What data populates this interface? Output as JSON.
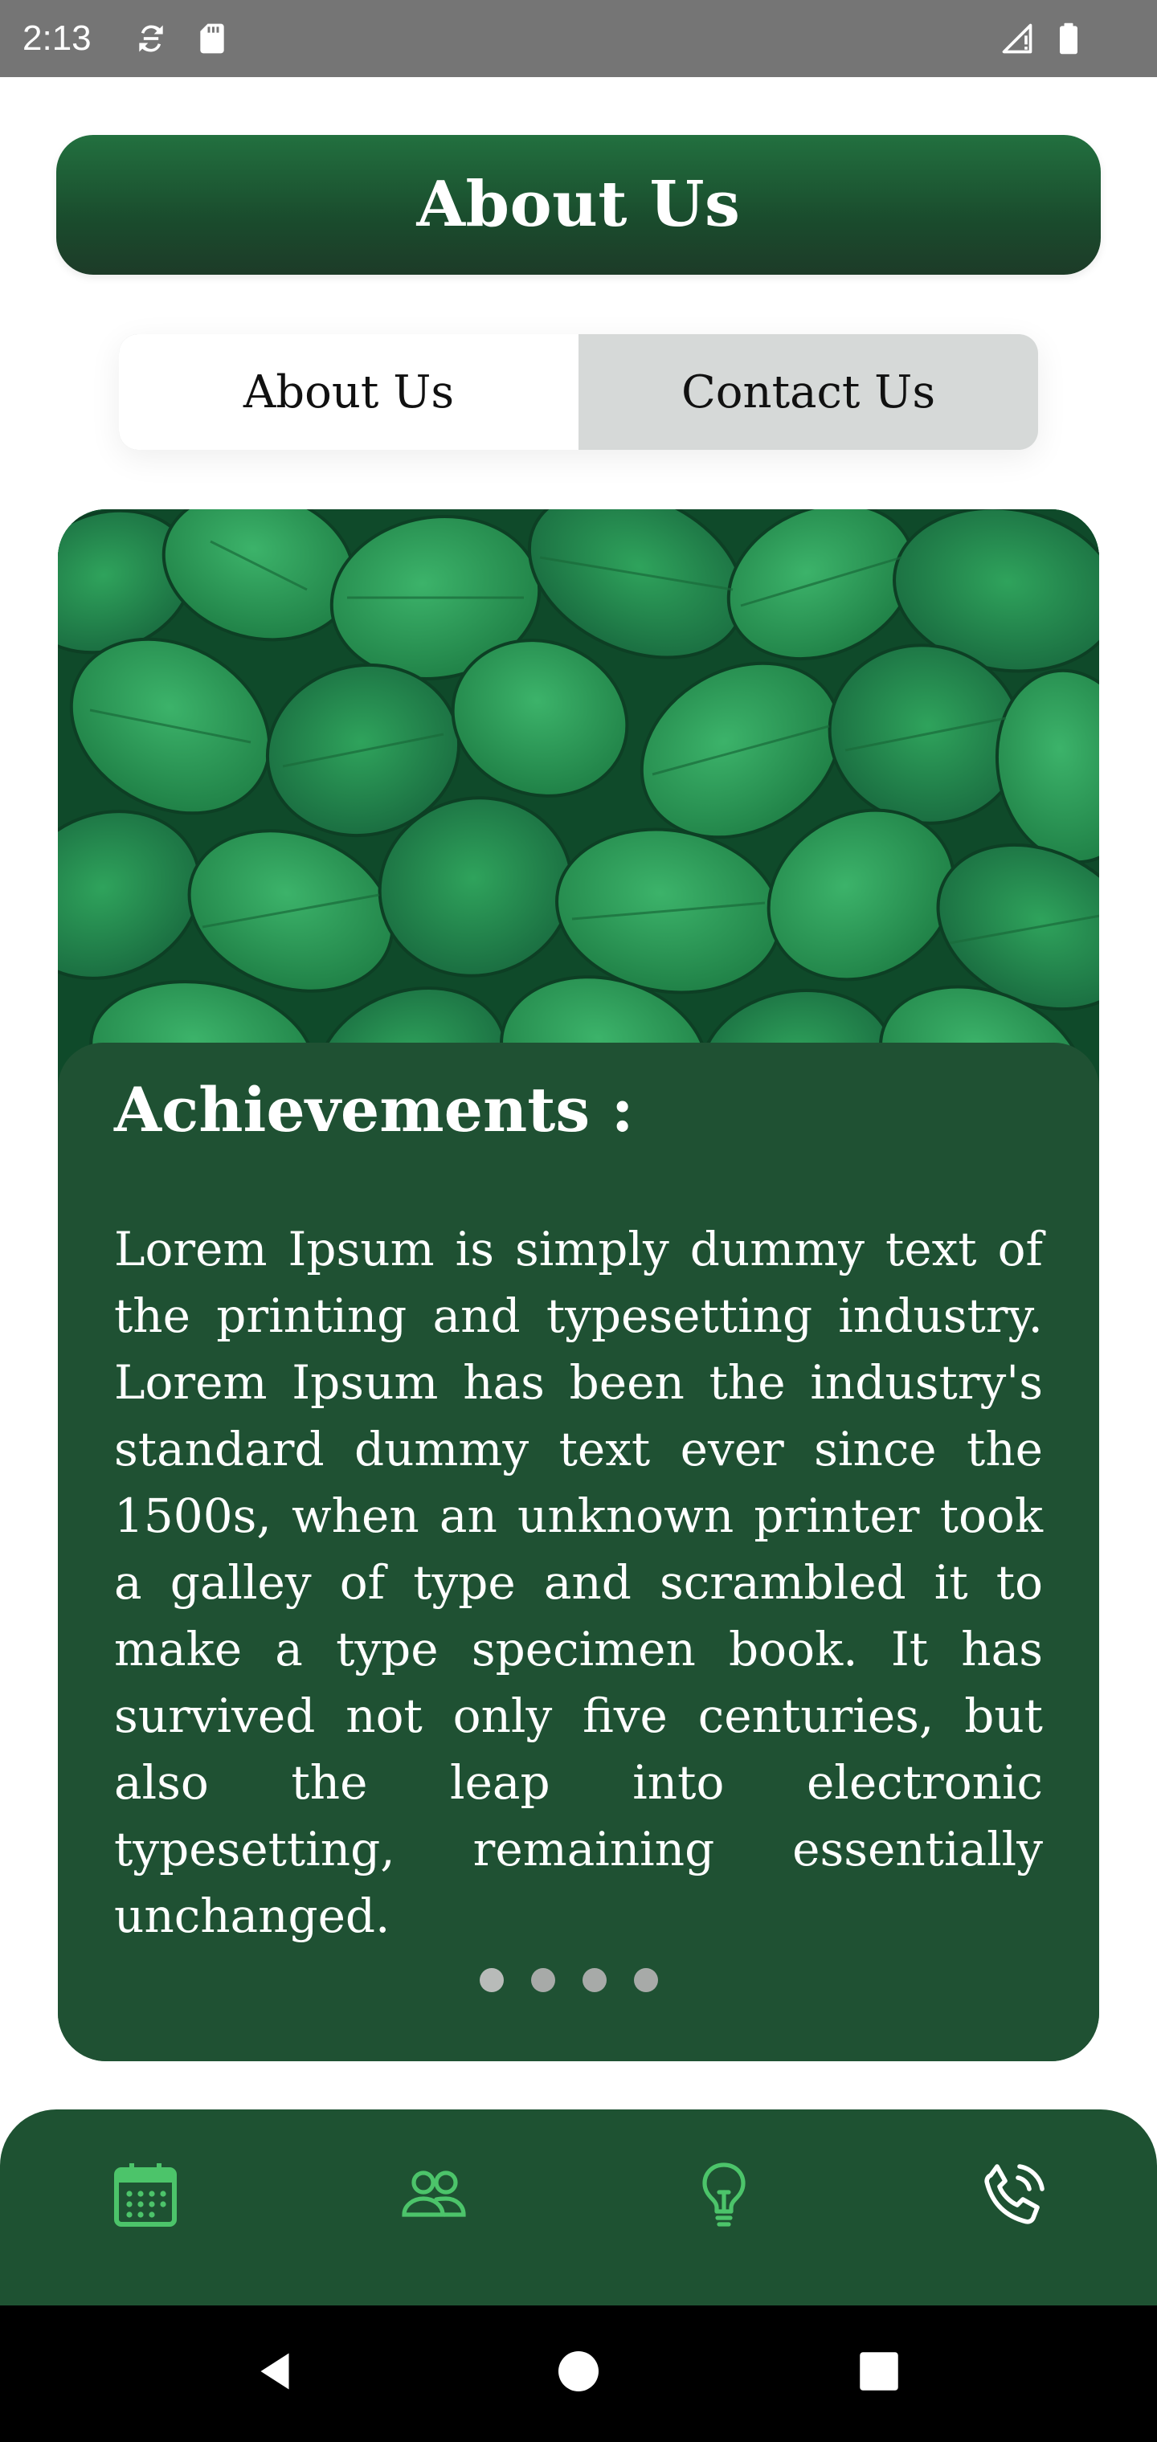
{
  "status_bar": {
    "time": "2:13",
    "icons": [
      "sync-icon",
      "sd-card-icon",
      "signal-icon",
      "battery-icon"
    ]
  },
  "header": {
    "title": "About Us"
  },
  "tabs": [
    {
      "label": "About Us",
      "active": true
    },
    {
      "label": "Contact Us",
      "active": false
    }
  ],
  "card": {
    "heading": "Achievements :",
    "body": "Lorem Ipsum is simply dummy text of the printing and typesetting industry. Lorem Ipsum has been the industry's standard dummy text ever since the 1500s, when an unknown printer took a galley of type and scrambled it to make a type specimen book. It has survived not only five centuries, but also the leap into electronic typesetting, remaining essentially unchanged.",
    "pagination": {
      "count": 4,
      "active_index": 0
    }
  },
  "bottom_nav": {
    "items": [
      {
        "icon": "calendar-icon",
        "active": false
      },
      {
        "icon": "people-icon",
        "active": false
      },
      {
        "icon": "lightbulb-icon",
        "active": false
      },
      {
        "icon": "phone-call-icon",
        "active": true
      }
    ],
    "inactive_color": "#4cc46a",
    "active_color": "#ffffff"
  },
  "colors": {
    "primary_green": "#1f5133",
    "status_bar": "#757575",
    "tab_inactive_bg": "#d6d9d8"
  }
}
